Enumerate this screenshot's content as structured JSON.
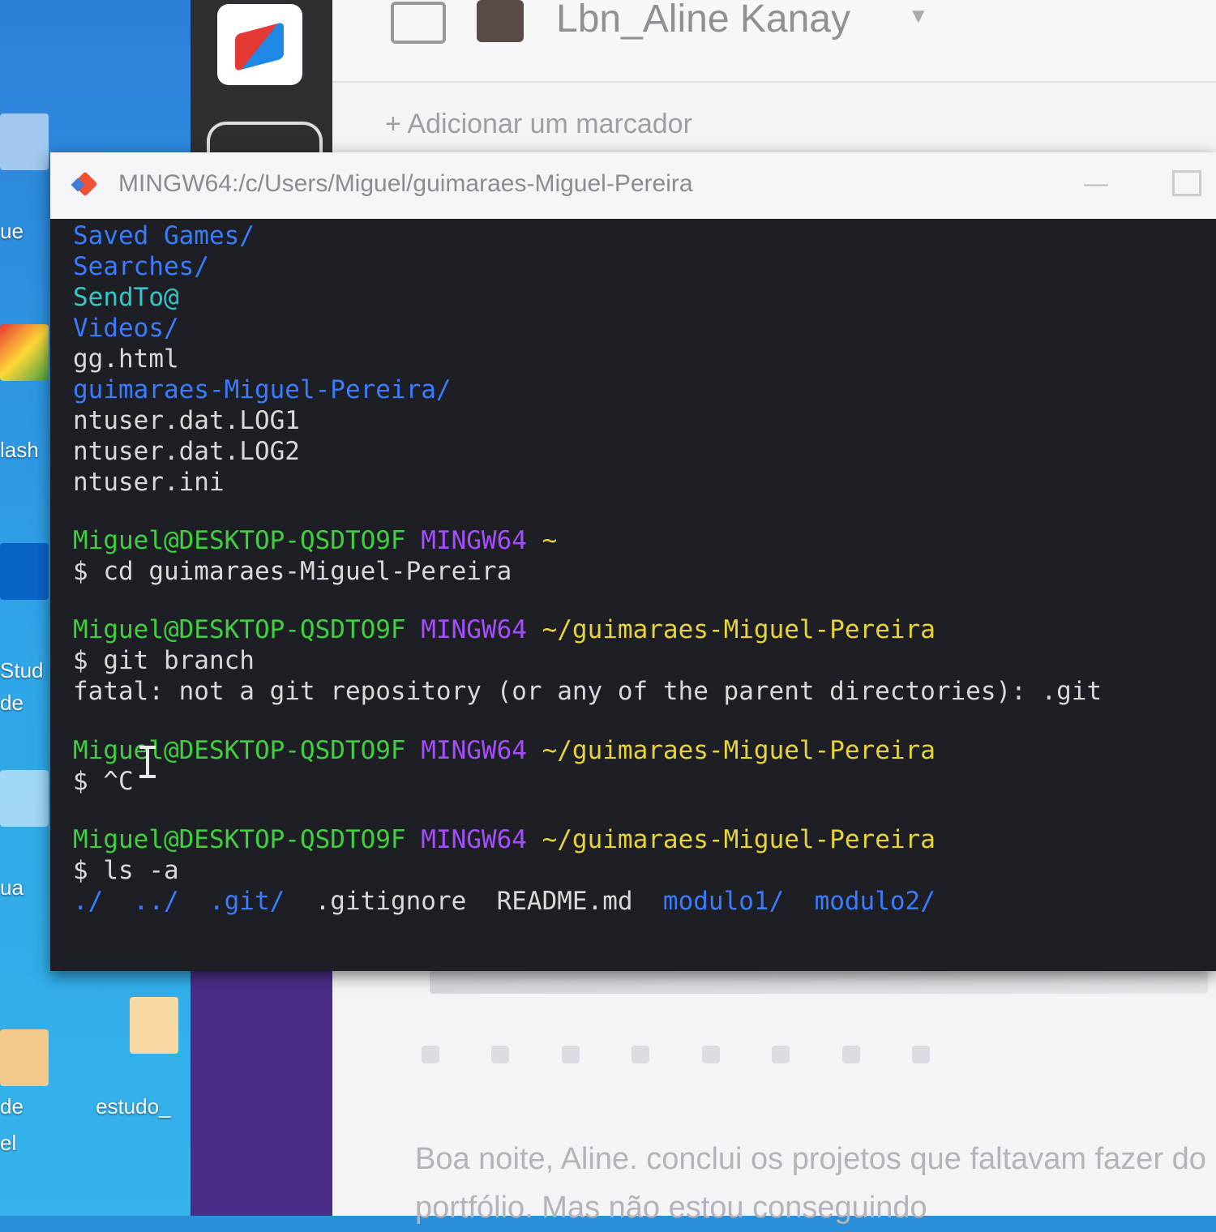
{
  "desktop": {
    "labels": [
      "ue",
      "lash",
      "Stud",
      "de",
      "ua",
      "de",
      "estudo_",
      "el"
    ]
  },
  "chat": {
    "title": "Lbn_Aline Kanay",
    "add_marker": "+ Adicionar um marcador",
    "message": "Boa noite, Aline. conclui os projetos que faltavam fazer do portfólio. Mas não estou conseguindo"
  },
  "terminal": {
    "title": "MINGW64:/c/Users/Miguel/guimaraes-Miguel-Pereira",
    "listing": [
      {
        "text": "Saved Games/",
        "color": "blue"
      },
      {
        "text": "Searches/",
        "color": "blue"
      },
      {
        "text": "SendTo@",
        "color": "cyan"
      },
      {
        "text": "Videos/",
        "color": "blue"
      },
      {
        "text": "gg.html",
        "color": "white"
      },
      {
        "text": "guimaraes-Miguel-Pereira/",
        "color": "blue"
      },
      {
        "text": "ntuser.dat.LOG1",
        "color": "white"
      },
      {
        "text": "ntuser.dat.LOG2",
        "color": "white"
      },
      {
        "text": "ntuser.ini",
        "color": "white"
      }
    ],
    "prompt_user": "Miguel@DESKTOP-QSDTO9F",
    "prompt_shell": "MINGW64",
    "blocks": [
      {
        "path": "~",
        "command": "$ cd guimaraes-Miguel-Pereira",
        "output": ""
      },
      {
        "path": "~/guimaraes-Miguel-Pereira",
        "command": "$ git branch",
        "output": "fatal: not a git repository (or any of the parent directories): .git"
      },
      {
        "path": "~/guimaraes-Miguel-Pereira",
        "command": "$ ^C",
        "output": ""
      },
      {
        "path": "~/guimaraes-Miguel-Pereira",
        "command": "$ ls -a",
        "output": ""
      }
    ],
    "ls_output": [
      {
        "text": "./",
        "color": "blue"
      },
      {
        "text": "../",
        "color": "blue"
      },
      {
        "text": ".git/",
        "color": "blue"
      },
      {
        "text": ".gitignore",
        "color": "white"
      },
      {
        "text": "README.md",
        "color": "white"
      },
      {
        "text": "modulo1/",
        "color": "blue"
      },
      {
        "text": "modulo2/",
        "color": "blue"
      }
    ]
  },
  "colors": {
    "blue": "#3a7bff",
    "cyan": "#37c6c6",
    "green": "#3fcf3f",
    "purple": "#a64dff",
    "yellow": "#e8d33a",
    "white": "#d9d9d9"
  }
}
